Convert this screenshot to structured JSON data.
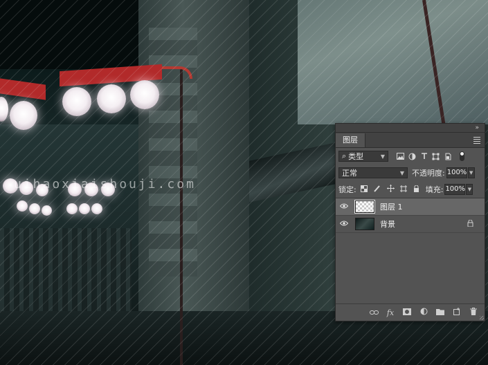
{
  "canvas": {
    "watermark": "uihaoxiaishouji.com"
  },
  "panel": {
    "collapse_icon": "»",
    "tab_label": "图层",
    "filter": {
      "search_icon": "⌕",
      "kind_label": "类型",
      "icons": [
        "image-filter-icon",
        "adjustment-filter-icon",
        "type-filter-icon",
        "shape-filter-icon",
        "smart-object-filter-icon"
      ]
    },
    "blend_mode": "正常",
    "opacity_label": "不透明度:",
    "opacity_value": "100%",
    "lock_label": "锁定:",
    "fill_label": "填充:",
    "fill_value": "100%",
    "layers": [
      {
        "name": "图层 1",
        "selected": true,
        "thumb": "transparent",
        "locked": false
      },
      {
        "name": "背景",
        "selected": false,
        "thumb": "photo",
        "locked": true
      }
    ]
  }
}
